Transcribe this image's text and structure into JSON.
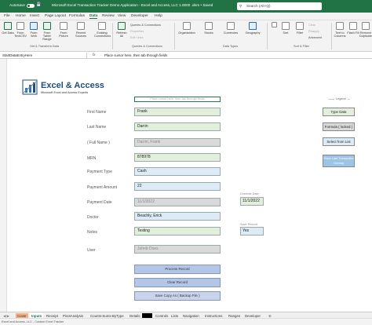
{
  "titlebar": {
    "autosave": "AutoSave",
    "autosave_state": "Off",
    "doc_title": "Microsoft Excel Transaction Tracker Demo Application - Excel and Access, LLC 1.0000 .xlsm • Saved",
    "search_placeholder": "Search (Alt+Q)"
  },
  "menu": [
    "File",
    "Home",
    "Insert",
    "Page Layout",
    "Formulas",
    "Data",
    "Review",
    "View",
    "Developer",
    "Help"
  ],
  "ribbon": {
    "get_data": "Get Data",
    "from_text": "From Text/CSV",
    "from_web": "From Web",
    "from_table": "From Table/ Range",
    "from_picture": "From Picture",
    "recent_sources": "Recent Sources",
    "existing_connections": "Existing Connections",
    "refresh_all": "Refresh All",
    "queries_connections": "Queries & Connections",
    "properties": "Properties",
    "edit_links": "Edit Links",
    "group_get_transform": "Get & Transform Data",
    "group_queries": "Queries & Connections",
    "organization": "Organization",
    "stocks": "Stocks",
    "currencies": "Currencies",
    "geography": "Geography",
    "group_data_types": "Data Types",
    "sort": "Sort",
    "filter": "Filter",
    "clear": "Clear",
    "reapply": "Reapply",
    "advanced": "Advanced",
    "group_sort_filter": "Sort & Filter",
    "text_to_columns": "Text to Columns",
    "flash_fill": "Flash Fill",
    "remove_duplicates": "Remove Duplicates"
  },
  "formulabar": {
    "namebox": "StartDataEntryHere",
    "fx": "fx",
    "formula": "Place cursor here, then tab through fields"
  },
  "logo": {
    "title": "Excel & Access",
    "subtitle": "Microsoft Excel and Access Experts"
  },
  "form": {
    "hint": "Place cursor here, then tab through fields",
    "fields": [
      {
        "label": "First Name",
        "value": "Frank",
        "style": "green"
      },
      {
        "label": "Last Name",
        "value": "Darrin",
        "style": "green"
      },
      {
        "label": "( Full Name )",
        "value": "Darrin, Frank",
        "style": "grey"
      },
      {
        "label": "MRN",
        "value": "878978",
        "style": "green"
      },
      {
        "label": "Payment Type",
        "value": "Cash",
        "style": "blue"
      },
      {
        "label": "Payment Amount",
        "value": "22",
        "style": "blue"
      },
      {
        "label": "Payment Date",
        "value": "11/1/2022",
        "style": "grey"
      },
      {
        "label": "Doctor",
        "value": "Beachly, Erick",
        "style": "blue"
      },
      {
        "label": "Notes",
        "value": "Testing",
        "style": "green"
      },
      {
        "label": "User",
        "value": "Johnb Does",
        "style": "grey"
      }
    ],
    "override_label": "Override Date",
    "override_value": "11/1/2022",
    "save_label": "Save Record",
    "save_value": "Yes",
    "buttons": [
      "Process Record",
      "Clear Record",
      "Save Copy As ( Backup File )"
    ]
  },
  "legend": {
    "title": "Legend",
    "items": [
      "Type Data",
      "Formula ( locked )",
      "Select from List",
      "Show Last Transaction Overlay"
    ]
  },
  "tabs": [
    "Cover",
    "Inputs",
    "Receipt",
    "PivotAnalysis",
    "Counts-Sums-ByType",
    "Details",
    "",
    "Controls",
    "Lists",
    "Navigation",
    "Instructions",
    "Ranges",
    "Developer"
  ],
  "status": "Excel and Access, LLC - Custom Excel Tracker"
}
